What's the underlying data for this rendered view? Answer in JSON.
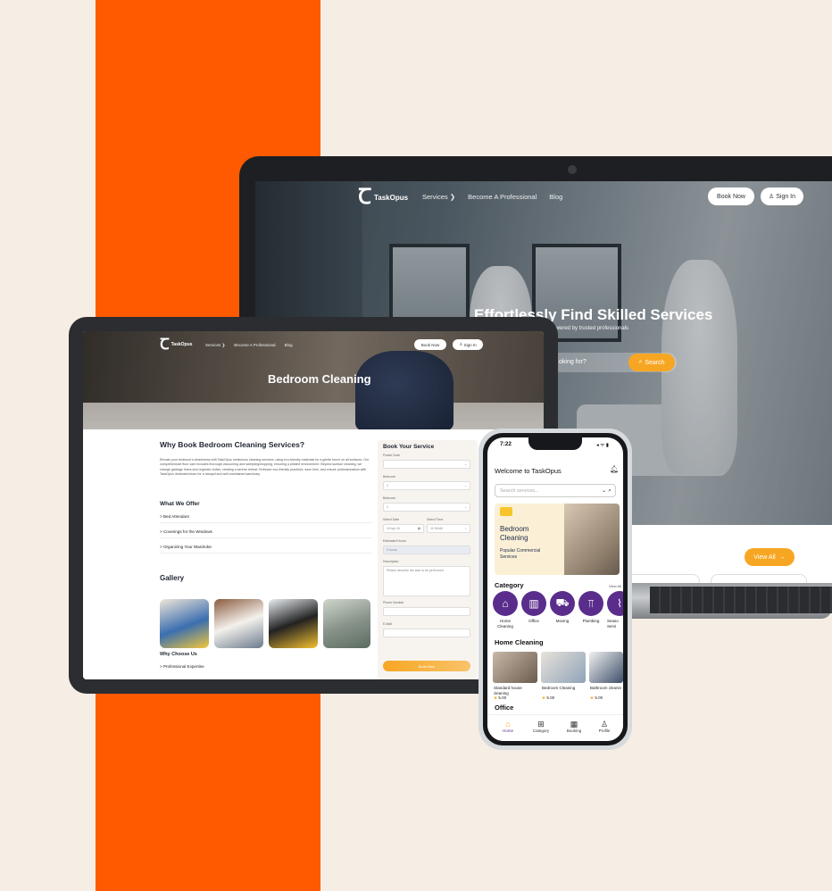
{
  "colors": {
    "background": "#f6ede4",
    "brand_orange": "#ff5a00",
    "accent_yellow": "#f7a623",
    "category_purple": "#5a2d8c"
  },
  "laptop": {
    "logo_text": "TaskOpus",
    "nav": [
      "Services ❯",
      "Become A Professional",
      "Blog"
    ],
    "book_now": "Book Now",
    "sign_in": "Sign In",
    "hero_title": "Effortlessly Find Skilled Services",
    "hero_subtitle": "powered by trusted professionals",
    "search_placeholder": "oking for?",
    "search_button": "Search",
    "view_all": "View All"
  },
  "tablet": {
    "logo_text": "TaskOpus",
    "nav": [
      "Services ❯",
      "Become A Professional",
      "Blog"
    ],
    "book_now": "Book Now",
    "sign_in": "Sign In",
    "hero_title": "Bedroom Cleaning",
    "why_book_title": "Why Book Bedroom Cleaning Services?",
    "why_book_text": "Elevate your bedroom's cleanliness with TaskOpus meticulous cleaning services, using eco-friendly materials for a gentle touch on all surfaces. Our comprehensive floor care includes thorough vacuuming and sweeping/mopping, ensuring a pristine environment. Beyond surface cleaning, we change garbage liners and organize clutter, creating a serene retreat. Embrace eco-friendly practices, save time, and ensure professionalism with TaskOpus dedicated team for a tranquil and well-maintained sanctuary.",
    "what_we_offer_title": "What We Offer",
    "offers": [
      "> Bed Attendant",
      "> Coverings for the Windows",
      "> Organizing Your Wardrobe"
    ],
    "gallery_title": "Gallery",
    "why_choose_title": "Why Choose Us",
    "why_choose_items": [
      "> Professional Expertise"
    ],
    "form": {
      "title": "Book Your Service",
      "postal_code_label": "Postal Code",
      "bedroom_label": "Bedroom",
      "bedroom_value": "1",
      "bathroom_label": "Bedroom",
      "bathroom_value": "1",
      "date_label": "Select Date",
      "date_value": "19 Apr 24",
      "time_label": "Select Time",
      "time_value": "11:30AM",
      "hours_label": "Estimated Hours",
      "hours_value": "3 hours",
      "description_label": "Description",
      "description_placeholder": "Please describe the task to be performed",
      "phone_label": "Phone Number",
      "email_label": "E-Mail",
      "submit": "Book Now"
    }
  },
  "phone": {
    "time": "7:22",
    "status": "◂ ᯤ ▮",
    "welcome": "Welcome to TaskOpus",
    "search_placeholder": "Search services...",
    "promo_title_1": "Bedroom",
    "promo_title_2": "Cleaning",
    "promo_sub_1": "Popular Commercial",
    "promo_sub_2": "Services",
    "category_title": "Category",
    "view_all": "View All",
    "categories": [
      {
        "label": "Home Cleaning",
        "icon": "home-icon"
      },
      {
        "label": "Office",
        "icon": "building-icon"
      },
      {
        "label": "Moving",
        "icon": "truck-icon"
      },
      {
        "label": "Plumbing",
        "icon": "pipe-icon"
      },
      {
        "label": "Seaso Servi",
        "icon": "broom-icon"
      }
    ],
    "home_cleaning_title": "Home Cleaning",
    "services": [
      {
        "name": "Standard house cleaning",
        "rating": "5.00"
      },
      {
        "name": "Bedroom Cleaning",
        "rating": "5.00"
      },
      {
        "name": "Bathroom cleanin",
        "rating": "5.00"
      }
    ],
    "office_title": "Office",
    "tabs": [
      "Home",
      "Category",
      "Booking",
      "Profile"
    ]
  }
}
